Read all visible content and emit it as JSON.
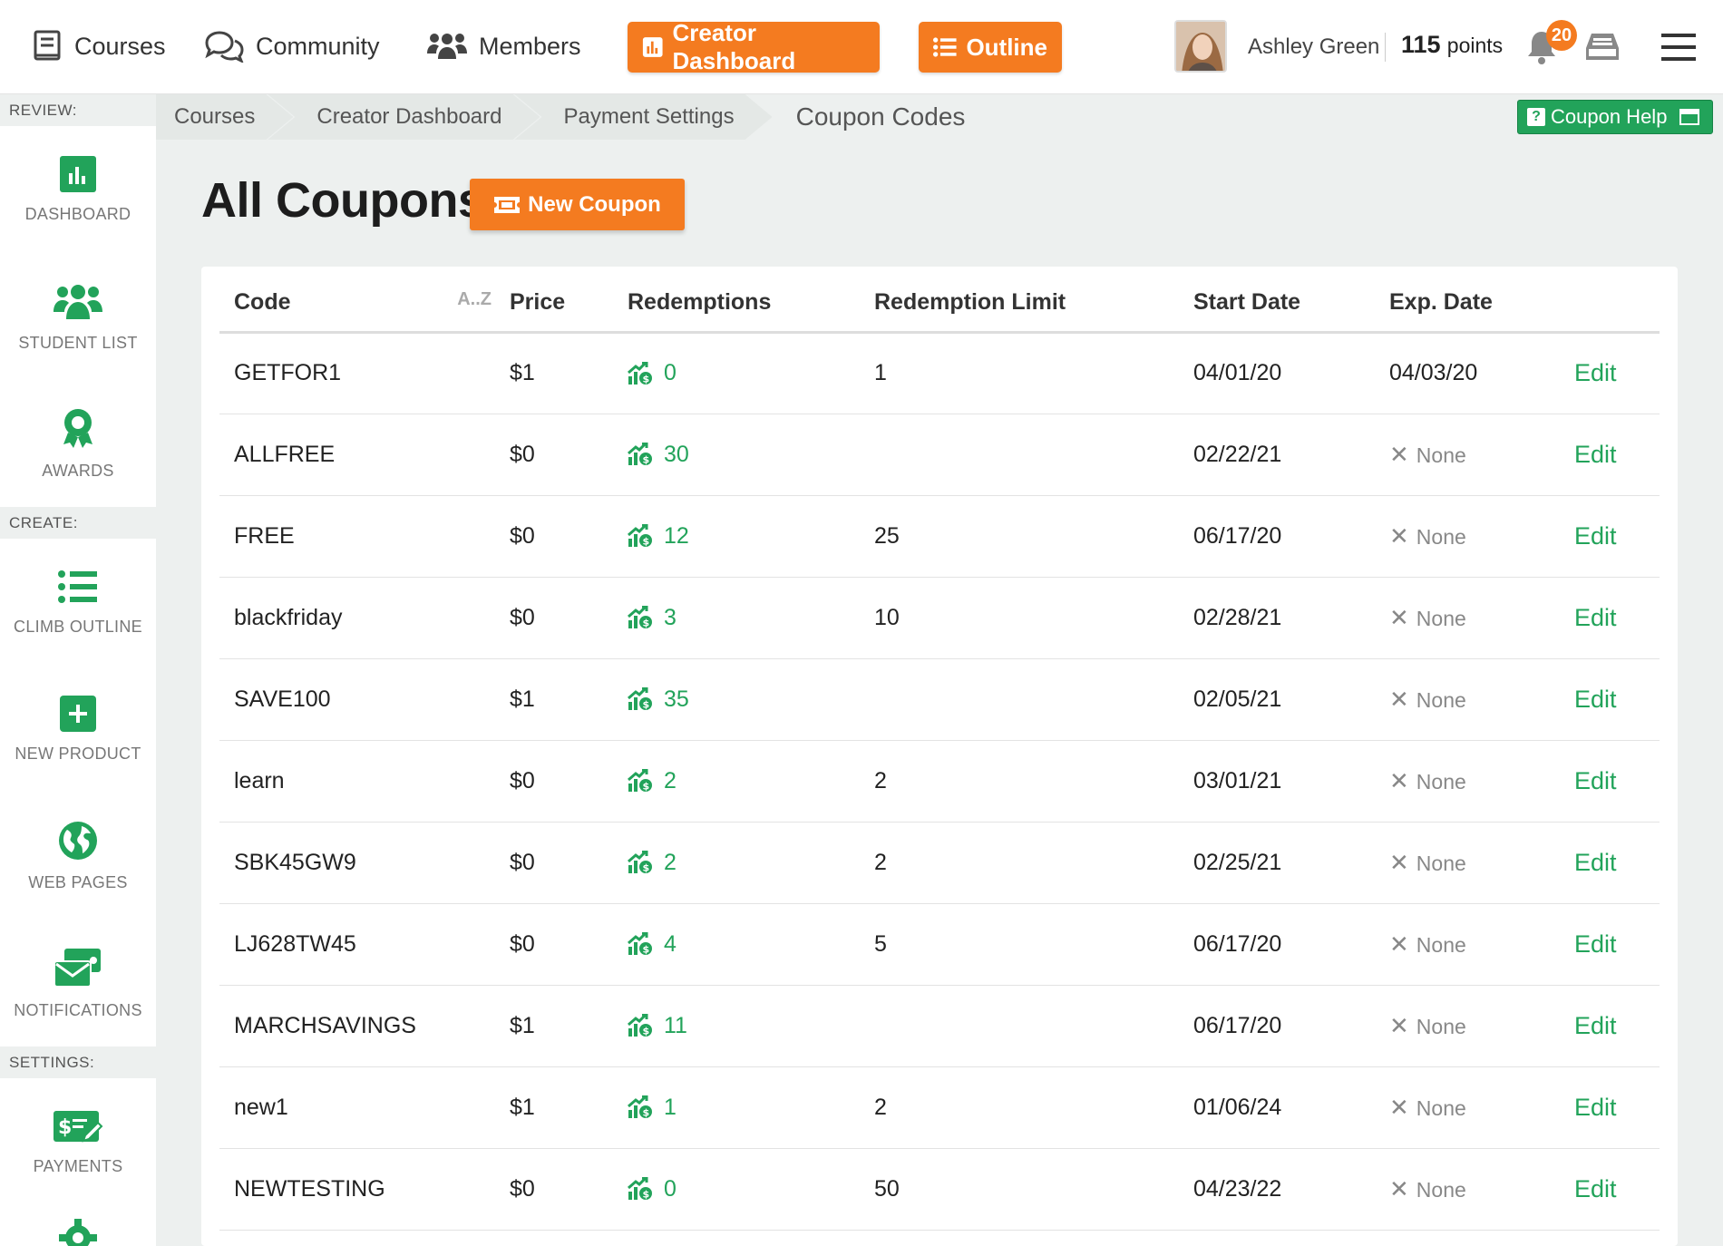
{
  "nav": {
    "courses": "Courses",
    "community": "Community",
    "members": "Members",
    "creator_dashboard": "Creator Dashboard",
    "outline": "Outline",
    "user_name": "Ashley Green",
    "points_value": "115",
    "points_label": "points",
    "notification_count": "20"
  },
  "sidebar": {
    "review": "REVIEW:",
    "create": "CREATE:",
    "settings": "SETTINGS:",
    "items": [
      {
        "label": "DASHBOARD",
        "icon": "bar-chart-icon"
      },
      {
        "label": "STUDENT LIST",
        "icon": "users-icon"
      },
      {
        "label": "AWARDS",
        "icon": "award-icon"
      },
      {
        "label": "CLIMB OUTLINE",
        "icon": "list-icon"
      },
      {
        "label": "NEW PRODUCT",
        "icon": "plus-square-icon"
      },
      {
        "label": "WEB PAGES",
        "icon": "globe-icon"
      },
      {
        "label": "NOTIFICATIONS",
        "icon": "mail-icon"
      },
      {
        "label": "PAYMENTS",
        "icon": "money-check-icon"
      }
    ]
  },
  "breadcrumb": [
    "Courses",
    "Creator Dashboard",
    "Payment Settings",
    "Coupon Codes"
  ],
  "help_label": "Coupon Help",
  "page_title": "All Coupons",
  "new_coupon_label": "New Coupon",
  "table": {
    "headers": [
      "Code",
      "Price",
      "Redemptions",
      "Redemption Limit",
      "Start Date",
      "Exp. Date"
    ],
    "sort_hint": "A..Z",
    "edit_label": "Edit",
    "none_label": "None",
    "rows": [
      {
        "code": "GETFOR1",
        "price": "$1",
        "redemptions": "0",
        "limit": "1",
        "start": "04/01/20",
        "exp": "04/03/20"
      },
      {
        "code": "ALLFREE",
        "price": "$0",
        "redemptions": "30",
        "limit": "",
        "start": "02/22/21",
        "exp": ""
      },
      {
        "code": "FREE",
        "price": "$0",
        "redemptions": "12",
        "limit": "25",
        "start": "06/17/20",
        "exp": ""
      },
      {
        "code": "blackfriday",
        "price": "$0",
        "redemptions": "3",
        "limit": "10",
        "start": "02/28/21",
        "exp": ""
      },
      {
        "code": "SAVE100",
        "price": "$1",
        "redemptions": "35",
        "limit": "",
        "start": "02/05/21",
        "exp": ""
      },
      {
        "code": "learn",
        "price": "$0",
        "redemptions": "2",
        "limit": "2",
        "start": "03/01/21",
        "exp": ""
      },
      {
        "code": "SBK45GW9",
        "price": "$0",
        "redemptions": "2",
        "limit": "2",
        "start": "02/25/21",
        "exp": ""
      },
      {
        "code": "LJ628TW45",
        "price": "$0",
        "redemptions": "4",
        "limit": "5",
        "start": "06/17/20",
        "exp": ""
      },
      {
        "code": "MARCHSAVINGS",
        "price": "$1",
        "redemptions": "11",
        "limit": "",
        "start": "06/17/20",
        "exp": ""
      },
      {
        "code": "new1",
        "price": "$1",
        "redemptions": "1",
        "limit": "2",
        "start": "01/06/24",
        "exp": ""
      },
      {
        "code": "NEWTESTING",
        "price": "$0",
        "redemptions": "0",
        "limit": "50",
        "start": "04/23/22",
        "exp": ""
      }
    ]
  },
  "colors": {
    "accent_orange": "#f47b20",
    "accent_green": "#22a35a"
  }
}
